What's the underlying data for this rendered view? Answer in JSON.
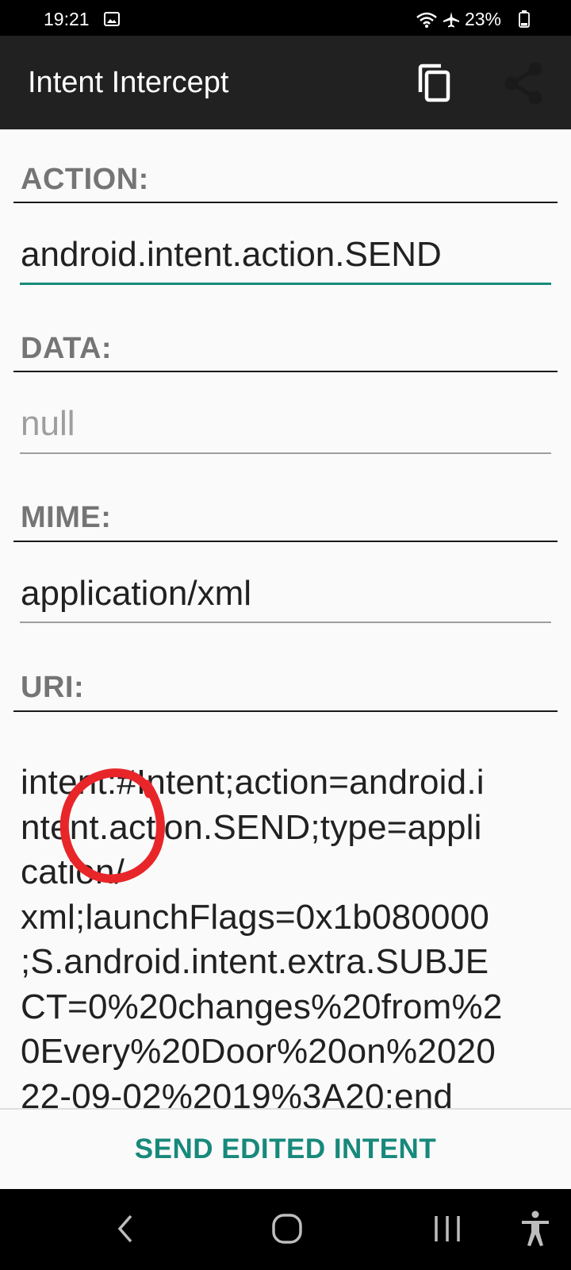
{
  "status_bar": {
    "time": "19:21",
    "battery": "23%"
  },
  "app_bar": {
    "title": "Intent Intercept",
    "icons": [
      "copy-icon",
      "share-icon"
    ]
  },
  "fields": {
    "action": {
      "label": "ACTION:",
      "value": "android.intent.action.SEND"
    },
    "data": {
      "label": "DATA:",
      "placeholder": "null"
    },
    "mime": {
      "label": "MIME:",
      "value": "application/xml"
    },
    "uri": {
      "label": "URI:",
      "value": "intent:#Intent;action=android.i\nntent.action.SEND;type=appli\ncation/\nxml;launchFlags=0x1b080000\n;S.android.intent.extra.SUBJE\nCT=0%20changes%20from%2\n0Every%20Door%20on%2020\n22-09-02%2019%3A20;end"
    }
  },
  "send_button": {
    "label": "SEND EDITED INTENT"
  },
  "colors": {
    "accent": "#17897b",
    "annotation": "#e8262a",
    "app_bar": "#212121"
  },
  "nav_bar": {
    "icons": [
      "back-icon",
      "home-icon",
      "recents-icon",
      "accessibility-icon"
    ]
  }
}
